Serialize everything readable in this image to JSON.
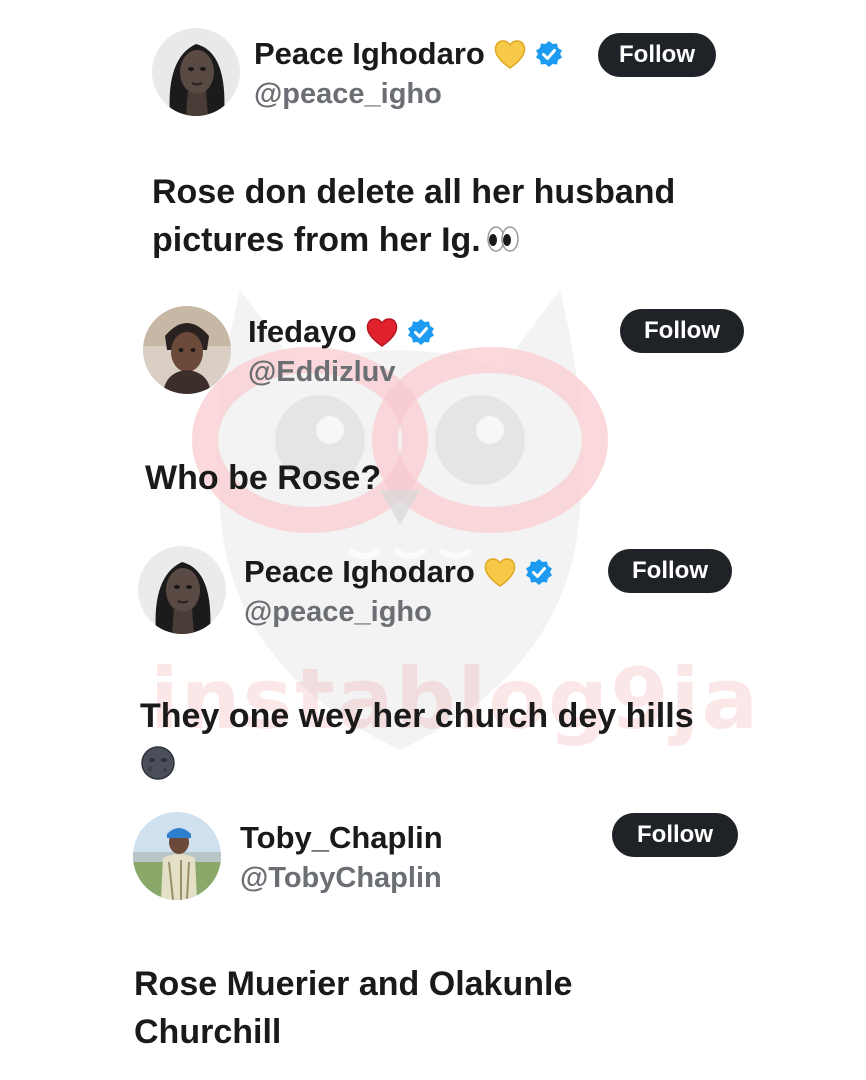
{
  "tweets": [
    {
      "name": "Peace Ighodaro",
      "handle": "@peace_igho",
      "name_emoji": "yellow-heart-icon",
      "verified": true,
      "follow_label": "Follow",
      "text": "Rose don delete all her husband\npictures from her Ig.",
      "text_emoji": "eyes-icon"
    },
    {
      "name": "Ifedayo",
      "handle": "@Eddizluv",
      "name_emoji": "red-heart-icon",
      "verified": true,
      "follow_label": "Follow",
      "text": "Who be Rose?"
    },
    {
      "name": "Peace Ighodaro",
      "handle": "@peace_igho",
      "name_emoji": "yellow-heart-icon",
      "verified": true,
      "follow_label": "Follow",
      "text": "They one wey her church dey hills",
      "text_emoji": "new-moon-face-icon"
    },
    {
      "name": "Toby_Chaplin",
      "handle": "@TobyChaplin",
      "verified": false,
      "follow_label": "Follow",
      "text": "Rose Muerier and Olakunle\nChurchill"
    }
  ],
  "watermark": {
    "text": "instablog9ja"
  },
  "colors": {
    "follow_bg": "#1f2226",
    "handle": "#6b6f73",
    "verified": "#1d9bf0",
    "watermark_pink": "#f07882"
  }
}
